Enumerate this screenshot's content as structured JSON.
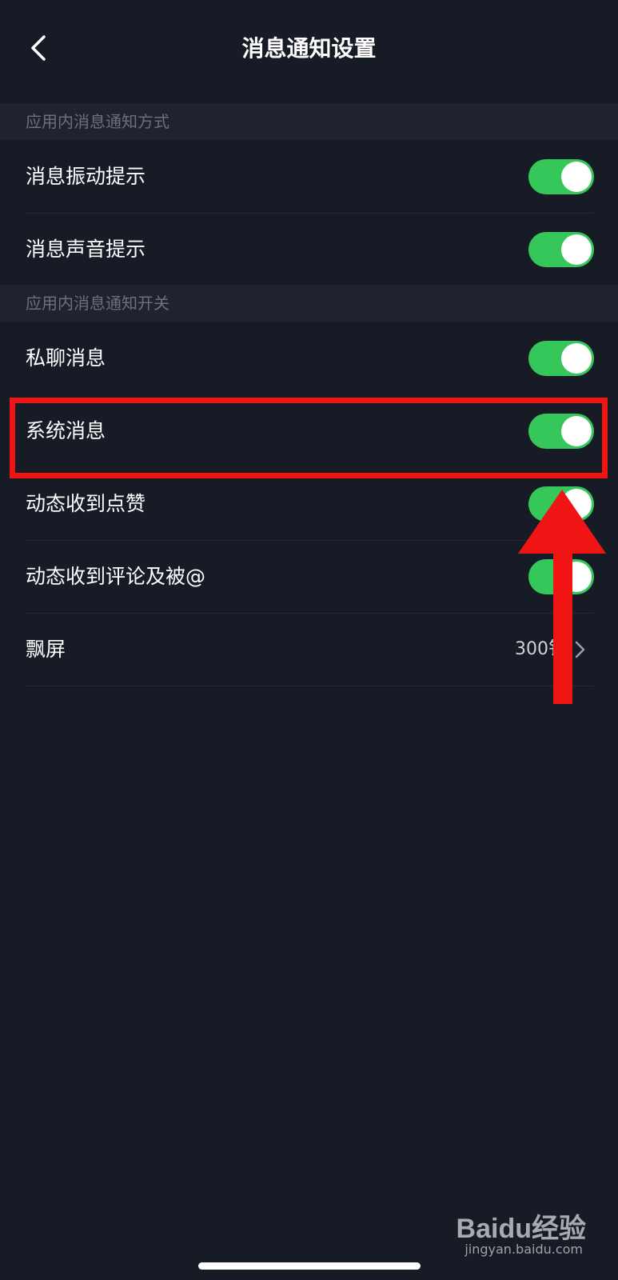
{
  "header": {
    "title": "消息通知设置",
    "back_icon": "chevron-left-icon"
  },
  "sections": [
    {
      "header": "应用内消息通知方式",
      "items": [
        {
          "label": "消息振动提示",
          "toggle_on": true
        },
        {
          "label": "消息声音提示",
          "toggle_on": true
        }
      ]
    },
    {
      "header": "应用内消息通知开关",
      "items": [
        {
          "label": "私聊消息",
          "toggle_on": true
        },
        {
          "label": "系统消息",
          "toggle_on": true
        },
        {
          "label": "动态收到点赞",
          "toggle_on": true
        },
        {
          "label": "动态收到评论及被@",
          "toggle_on": true
        },
        {
          "label": "飘屏",
          "value": "300钅",
          "chevron_icon": "chevron-right-icon"
        }
      ]
    }
  ],
  "annotation": {
    "highlight_target": "系统消息",
    "arrow_icon": "up-arrow-icon",
    "color": "#f01414"
  },
  "colors": {
    "background": "#171b25",
    "section_bg": "#1f232d",
    "toggle_on": "#35c759"
  },
  "watermark": {
    "brand": "Baidu经验",
    "url": "jingyan.baidu.com"
  }
}
